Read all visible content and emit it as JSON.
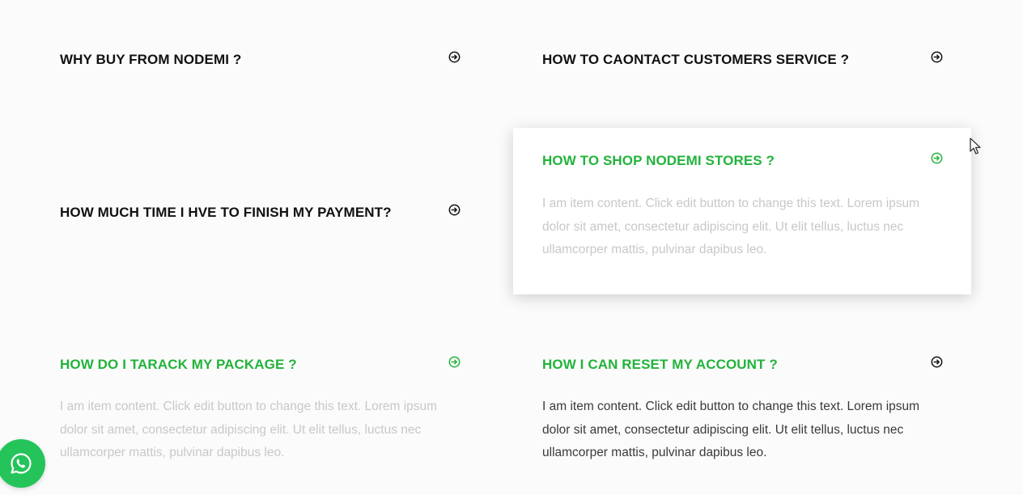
{
  "faq": {
    "items": [
      {
        "title": "WHY BUY FROM NODEMI ?",
        "content": ""
      },
      {
        "title": "HOW TO CAONTACT CUSTOMERS SERVICE ?",
        "content": ""
      },
      {
        "title": "HOW MUCH TIME I HVE TO FINISH MY PAYMENT?",
        "content": ""
      },
      {
        "title": "HOW TO SHOP NODEMI STORES ?",
        "content": "I am item content. Click edit button to change this text. Lorem ipsum dolor sit amet, consectetur adipiscing elit. Ut elit tellus, luctus nec ullamcorper mattis, pulvinar dapibus leo."
      },
      {
        "title": "HOW DO I TARACK MY PACKAGE ?",
        "content": "I am item content. Click edit button to change this text. Lorem ipsum dolor sit amet, consectetur adipiscing elit. Ut elit tellus, luctus nec ullamcorper mattis, pulvinar dapibus leo."
      },
      {
        "title": "HOW I CAN RESET MY ACCOUNT ?",
        "content": "I am item content. Click edit button to change this text. Lorem ipsum dolor sit amet, consectetur adipiscing elit. Ut elit tellus, luctus nec ullamcorper mattis, pulvinar dapibus leo."
      }
    ],
    "arrow_icon": "arrow-right-circle-icon"
  },
  "whatsapp": {
    "icon": "whatsapp-icon"
  },
  "colors": {
    "accent_green": "#22b33b",
    "heading_dark": "#111111",
    "text_faded": "#c8c8c8",
    "text_dark": "#3a3a3a",
    "whatsapp_green": "#25c45a"
  }
}
